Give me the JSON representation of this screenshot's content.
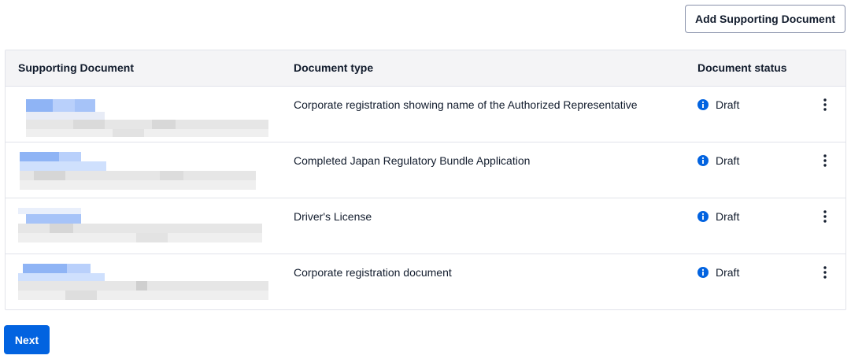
{
  "actions": {
    "add_document_label": "Add Supporting Document",
    "next_label": "Next"
  },
  "table": {
    "headers": {
      "document": "Supporting Document",
      "type": "Document type",
      "status": "Document status"
    },
    "rows": [
      {
        "type": "Corporate registration showing name of the Authorized Representative",
        "status": "Draft",
        "status_icon": "info-icon"
      },
      {
        "type": "Completed Japan Regulatory Bundle Application",
        "status": "Draft",
        "status_icon": "info-icon"
      },
      {
        "type": "Driver's License",
        "status": "Draft",
        "status_icon": "info-icon"
      },
      {
        "type": "Corporate registration document",
        "status": "Draft",
        "status_icon": "info-icon"
      }
    ]
  },
  "colors": {
    "primary": "#0263e0",
    "info": "#0263e0",
    "border": "#e1e3ea",
    "header_bg": "#f4f4f6"
  }
}
